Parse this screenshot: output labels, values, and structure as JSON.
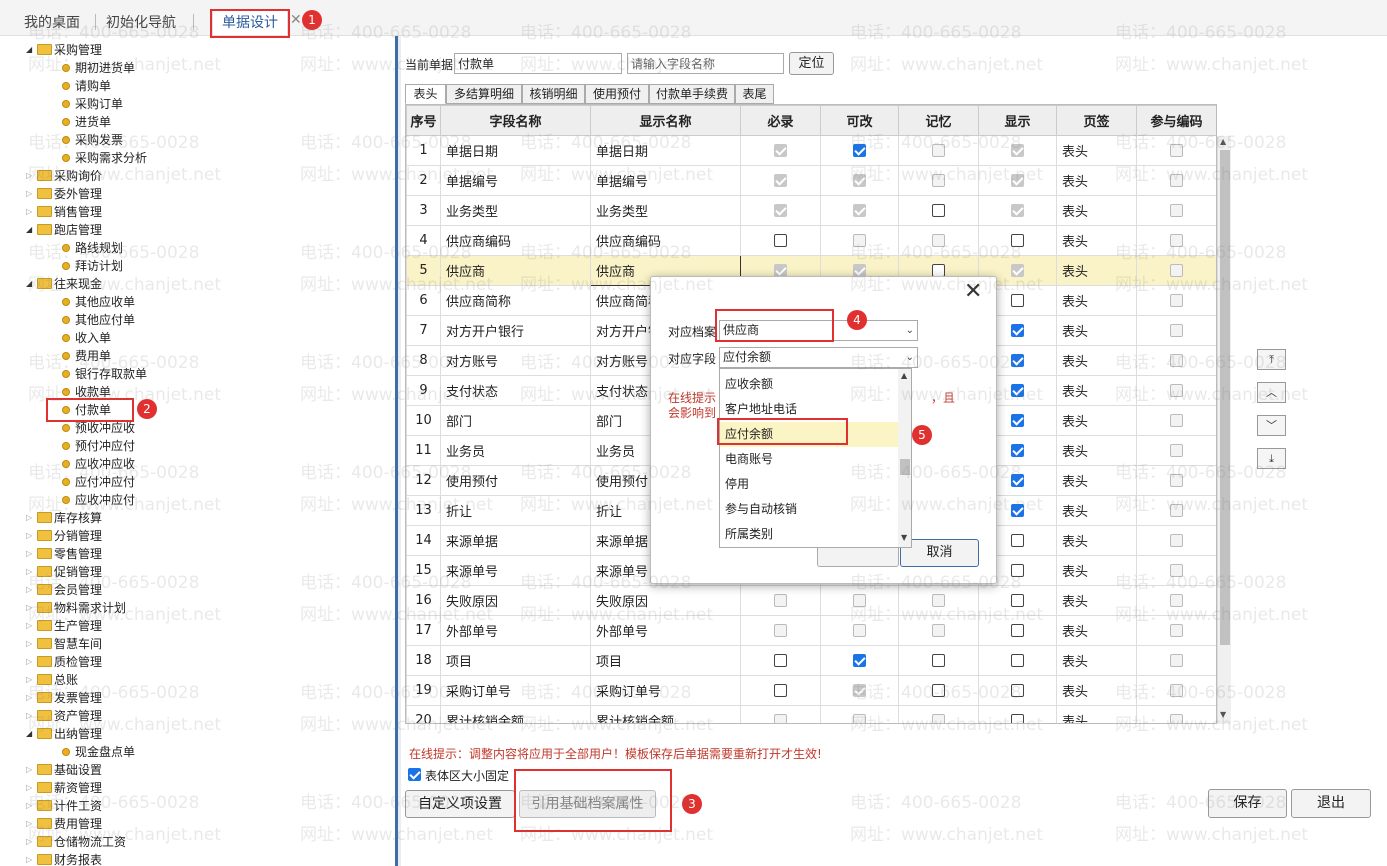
{
  "top_tabs": [
    "我的桌面",
    "初始化导航",
    "单据设计"
  ],
  "badges": [
    "1",
    "2",
    "3",
    "4",
    "5"
  ],
  "tree": [
    {
      "label": "采购管理",
      "level": 0,
      "open": true
    },
    {
      "label": "期初进货单",
      "level": 1
    },
    {
      "label": "请购单",
      "level": 1
    },
    {
      "label": "采购订单",
      "level": 1
    },
    {
      "label": "进货单",
      "level": 1
    },
    {
      "label": "采购发票",
      "level": 1
    },
    {
      "label": "采购需求分析",
      "level": 1
    },
    {
      "label": "采购询价",
      "level": 0,
      "open": false
    },
    {
      "label": "委外管理",
      "level": 0,
      "open": false
    },
    {
      "label": "销售管理",
      "level": 0,
      "open": false
    },
    {
      "label": "跑店管理",
      "level": 0,
      "open": true
    },
    {
      "label": "路线规划",
      "level": 1
    },
    {
      "label": "拜访计划",
      "level": 1
    },
    {
      "label": "往来现金",
      "level": 0,
      "open": true
    },
    {
      "label": "其他应收单",
      "level": 1
    },
    {
      "label": "其他应付单",
      "level": 1
    },
    {
      "label": "收入单",
      "level": 1
    },
    {
      "label": "费用单",
      "level": 1
    },
    {
      "label": "银行存取款单",
      "level": 1
    },
    {
      "label": "收款单",
      "level": 1
    },
    {
      "label": "付款单",
      "level": 1
    },
    {
      "label": "预收冲应收",
      "level": 1
    },
    {
      "label": "预付冲应付",
      "level": 1
    },
    {
      "label": "应收冲应收",
      "level": 1
    },
    {
      "label": "应付冲应付",
      "level": 1
    },
    {
      "label": "应收冲应付",
      "level": 1
    },
    {
      "label": "库存核算",
      "level": 0,
      "open": false
    },
    {
      "label": "分销管理",
      "level": 0,
      "open": false
    },
    {
      "label": "零售管理",
      "level": 0,
      "open": false
    },
    {
      "label": "促销管理",
      "level": 0,
      "open": false
    },
    {
      "label": "会员管理",
      "level": 0,
      "open": false
    },
    {
      "label": "物料需求计划",
      "level": 0,
      "open": false
    },
    {
      "label": "生产管理",
      "level": 0,
      "open": false
    },
    {
      "label": "智慧车间",
      "level": 0,
      "open": false
    },
    {
      "label": "质检管理",
      "level": 0,
      "open": false
    },
    {
      "label": "总账",
      "level": 0,
      "open": false
    },
    {
      "label": "发票管理",
      "level": 0,
      "open": false
    },
    {
      "label": "资产管理",
      "level": 0,
      "open": false
    },
    {
      "label": "出纳管理",
      "level": 0,
      "open": true
    },
    {
      "label": "现金盘点单",
      "level": 1
    },
    {
      "label": "基础设置",
      "level": 0,
      "open": false
    },
    {
      "label": "薪资管理",
      "level": 0,
      "open": false
    },
    {
      "label": "计件工资",
      "level": 0,
      "open": false
    },
    {
      "label": "费用管理",
      "level": 0,
      "open": false
    },
    {
      "label": "仓储物流工资",
      "level": 0,
      "open": false
    },
    {
      "label": "财务报表",
      "level": 0,
      "open": false
    }
  ],
  "form": {
    "current_label": "当前单据",
    "current_value": "付款单",
    "search_placeholder": "请输入字段名称",
    "locate_button": "定位"
  },
  "sub_tabs": [
    "表头",
    "多结算明细",
    "核销明细",
    "使用预付",
    "付款单手续费",
    "表尾"
  ],
  "columns": [
    "序号",
    "字段名称",
    "显示名称",
    "必录",
    "可改",
    "记忆",
    "显示",
    "页签",
    "参与编码"
  ],
  "rows": [
    {
      "no": "1",
      "field": "单据日期",
      "display": "单据日期",
      "req": [
        1,
        1
      ],
      "edit": [
        1,
        0
      ],
      "mem": [
        0,
        1
      ],
      "show": [
        1,
        1
      ],
      "tab": "表头",
      "code": [
        0,
        1
      ]
    },
    {
      "no": "2",
      "field": "单据编号",
      "display": "单据编号",
      "req": [
        1,
        1
      ],
      "edit": [
        1,
        1
      ],
      "mem": [
        0,
        1
      ],
      "show": [
        1,
        1
      ],
      "tab": "表头",
      "code": [
        0,
        1
      ]
    },
    {
      "no": "3",
      "field": "业务类型",
      "display": "业务类型",
      "req": [
        1,
        1
      ],
      "edit": [
        1,
        1
      ],
      "mem": [
        0,
        0
      ],
      "show": [
        1,
        1
      ],
      "tab": "表头",
      "code": [
        0,
        1
      ]
    },
    {
      "no": "4",
      "field": "供应商编码",
      "display": "供应商编码",
      "req": [
        0,
        0
      ],
      "edit": [
        0,
        1
      ],
      "mem": [
        0,
        1
      ],
      "show": [
        0,
        0
      ],
      "tab": "表头",
      "code": [
        0,
        1
      ]
    },
    {
      "no": "5",
      "field": "供应商",
      "display": "供应商",
      "req": [
        1,
        1
      ],
      "edit": [
        1,
        1
      ],
      "mem": [
        0,
        0
      ],
      "show": [
        1,
        1
      ],
      "tab": "表头",
      "code": [
        0,
        1
      ],
      "selected": true
    },
    {
      "no": "6",
      "field": "供应商简称",
      "display": "供应商简称",
      "req": [
        0,
        0
      ],
      "edit": [
        0,
        0
      ],
      "mem": [
        0,
        0
      ],
      "show": [
        0,
        0
      ],
      "tab": "表头",
      "code": [
        0,
        1
      ]
    },
    {
      "no": "7",
      "field": "对方开户银行",
      "display": "对方开户银行",
      "req": [
        0,
        0
      ],
      "edit": [
        0,
        0
      ],
      "mem": [
        0,
        0
      ],
      "show": [
        1,
        0
      ],
      "tab": "表头",
      "code": [
        0,
        1
      ]
    },
    {
      "no": "8",
      "field": "对方账号",
      "display": "对方账号",
      "req": [
        0,
        0
      ],
      "edit": [
        0,
        0
      ],
      "mem": [
        0,
        0
      ],
      "show": [
        1,
        0
      ],
      "tab": "表头",
      "code": [
        0,
        1
      ]
    },
    {
      "no": "9",
      "field": "支付状态",
      "display": "支付状态",
      "req": [
        0,
        0
      ],
      "edit": [
        0,
        0
      ],
      "mem": [
        0,
        0
      ],
      "show": [
        1,
        0
      ],
      "tab": "表头",
      "code": [
        0,
        1
      ]
    },
    {
      "no": "10",
      "field": "部门",
      "display": "部门",
      "req": [
        0,
        0
      ],
      "edit": [
        0,
        0
      ],
      "mem": [
        0,
        0
      ],
      "show": [
        1,
        0
      ],
      "tab": "表头",
      "code": [
        0,
        1
      ]
    },
    {
      "no": "11",
      "field": "业务员",
      "display": "业务员",
      "req": [
        0,
        0
      ],
      "edit": [
        0,
        0
      ],
      "mem": [
        0,
        0
      ],
      "show": [
        1,
        0
      ],
      "tab": "表头",
      "code": [
        0,
        1
      ]
    },
    {
      "no": "12",
      "field": "使用预付",
      "display": "使用预付",
      "req": [
        0,
        0
      ],
      "edit": [
        0,
        0
      ],
      "mem": [
        0,
        0
      ],
      "show": [
        1,
        0
      ],
      "tab": "表头",
      "code": [
        0,
        1
      ]
    },
    {
      "no": "13",
      "field": "折让",
      "display": "折让",
      "req": [
        0,
        0
      ],
      "edit": [
        0,
        0
      ],
      "mem": [
        0,
        0
      ],
      "show": [
        1,
        0
      ],
      "tab": "表头",
      "code": [
        0,
        1
      ]
    },
    {
      "no": "14",
      "field": "来源单据",
      "display": "来源单据",
      "req": [
        0,
        0
      ],
      "edit": [
        0,
        0
      ],
      "mem": [
        0,
        0
      ],
      "show": [
        0,
        0
      ],
      "tab": "表头",
      "code": [
        0,
        1
      ]
    },
    {
      "no": "15",
      "field": "来源单号",
      "display": "来源单号",
      "req": [
        0,
        0
      ],
      "edit": [
        0,
        0
      ],
      "mem": [
        0,
        0
      ],
      "show": [
        0,
        0
      ],
      "tab": "表头",
      "code": [
        0,
        1
      ]
    },
    {
      "no": "16",
      "field": "失败原因",
      "display": "失败原因",
      "req": [
        0,
        1
      ],
      "edit": [
        0,
        1
      ],
      "mem": [
        0,
        1
      ],
      "show": [
        0,
        0
      ],
      "tab": "表头",
      "code": [
        0,
        1
      ]
    },
    {
      "no": "17",
      "field": "外部单号",
      "display": "外部单号",
      "req": [
        0,
        1
      ],
      "edit": [
        0,
        1
      ],
      "mem": [
        0,
        1
      ],
      "show": [
        0,
        0
      ],
      "tab": "表头",
      "code": [
        0,
        1
      ]
    },
    {
      "no": "18",
      "field": "项目",
      "display": "项目",
      "req": [
        0,
        0
      ],
      "edit": [
        1,
        0
      ],
      "mem": [
        0,
        0
      ],
      "show": [
        0,
        0
      ],
      "tab": "表头",
      "code": [
        0,
        1
      ]
    },
    {
      "no": "19",
      "field": "采购订单号",
      "display": "采购订单号",
      "req": [
        0,
        0
      ],
      "edit": [
        1,
        1
      ],
      "mem": [
        0,
        0
      ],
      "show": [
        0,
        0
      ],
      "tab": "表头",
      "code": [
        0,
        1
      ]
    },
    {
      "no": "20",
      "field": "累计核销余额",
      "display": "累计核销余额",
      "req": [
        0,
        1
      ],
      "edit": [
        0,
        1
      ],
      "mem": [
        0,
        1
      ],
      "show": [
        0,
        0
      ],
      "tab": "表头",
      "code": [
        0,
        1
      ]
    }
  ],
  "bottom": {
    "tip": "在线提示：调整内容将应用于全部用户！模板保存后单据需要重新打开才生效!",
    "fixed_size_label": "表体区大小固定",
    "custom_button": "自定义项设置",
    "ref_button": "引用基础档案属性",
    "save_button": "保存",
    "exit_button": "退出"
  },
  "dialog": {
    "archive_label": "对应档案",
    "archive_value": "供应商",
    "field_label": "对应字段",
    "field_value": "应付余额",
    "tip_line1": "在线提示",
    "tip_tail1": "，且",
    "tip_line2": "会影响到",
    "cancel_button": "取消",
    "options": [
      "应收余额",
      "客户地址电话",
      "应付余额",
      "电商账号",
      "停用",
      "参与自动核销",
      "所属类别"
    ]
  },
  "watermark": [
    "电话：400-665-0028",
    "网址：www.chanjet.net"
  ],
  "colors": {
    "accent": "#3d6ea8",
    "highlight": "#e03030",
    "selected_row": "#faf3c8"
  }
}
